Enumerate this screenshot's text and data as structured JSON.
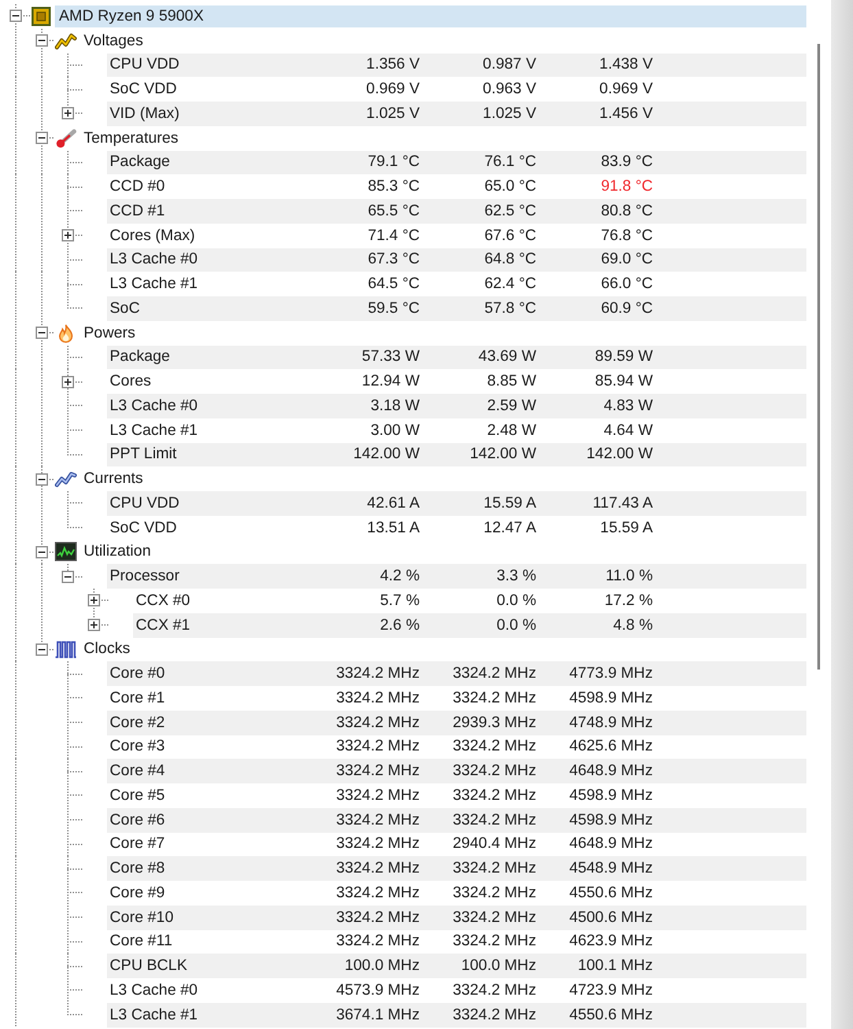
{
  "device": {
    "name": "AMD Ryzen 9 5900X",
    "expanded": true,
    "groups": [
      {
        "kind": "voltages",
        "label": "Voltages",
        "expanded": true,
        "sensors": [
          {
            "label": "CPU VDD",
            "values": [
              "1.356 V",
              "0.987 V",
              "1.438 V"
            ],
            "alerts": [
              false,
              false,
              false
            ]
          },
          {
            "label": "SoC VDD",
            "values": [
              "0.969 V",
              "0.963 V",
              "0.969 V"
            ],
            "alerts": [
              false,
              false,
              false
            ]
          },
          {
            "label": "VID (Max)",
            "expanded": false,
            "values": [
              "1.025 V",
              "1.025 V",
              "1.456 V"
            ],
            "alerts": [
              false,
              false,
              false
            ]
          }
        ]
      },
      {
        "kind": "temperatures",
        "label": "Temperatures",
        "expanded": true,
        "sensors": [
          {
            "label": "Package",
            "values": [
              "79.1 °C",
              "76.1 °C",
              "83.9 °C"
            ],
            "alerts": [
              false,
              false,
              false
            ]
          },
          {
            "label": "CCD #0",
            "values": [
              "85.3 °C",
              "65.0 °C",
              "91.8 °C"
            ],
            "alerts": [
              false,
              false,
              true
            ]
          },
          {
            "label": "CCD #1",
            "values": [
              "65.5 °C",
              "62.5 °C",
              "80.8 °C"
            ],
            "alerts": [
              false,
              false,
              false
            ]
          },
          {
            "label": "Cores (Max)",
            "expanded": false,
            "values": [
              "71.4 °C",
              "67.6 °C",
              "76.8 °C"
            ],
            "alerts": [
              false,
              false,
              false
            ]
          },
          {
            "label": "L3 Cache #0",
            "values": [
              "67.3 °C",
              "64.8 °C",
              "69.0 °C"
            ],
            "alerts": [
              false,
              false,
              false
            ]
          },
          {
            "label": "L3 Cache #1",
            "values": [
              "64.5 °C",
              "62.4 °C",
              "66.0 °C"
            ],
            "alerts": [
              false,
              false,
              false
            ]
          },
          {
            "label": "SoC",
            "values": [
              "59.5 °C",
              "57.8 °C",
              "60.9 °C"
            ],
            "alerts": [
              false,
              false,
              false
            ]
          }
        ]
      },
      {
        "kind": "powers",
        "label": "Powers",
        "expanded": true,
        "sensors": [
          {
            "label": "Package",
            "values": [
              "57.33 W",
              "43.69 W",
              "89.59 W"
            ],
            "alerts": [
              false,
              false,
              false
            ]
          },
          {
            "label": "Cores",
            "expanded": false,
            "values": [
              "12.94 W",
              "8.85 W",
              "85.94 W"
            ],
            "alerts": [
              false,
              false,
              false
            ]
          },
          {
            "label": "L3 Cache #0",
            "values": [
              "3.18 W",
              "2.59 W",
              "4.83 W"
            ],
            "alerts": [
              false,
              false,
              false
            ]
          },
          {
            "label": "L3 Cache #1",
            "values": [
              "3.00 W",
              "2.48 W",
              "4.64 W"
            ],
            "alerts": [
              false,
              false,
              false
            ]
          },
          {
            "label": "PPT Limit",
            "values": [
              "142.00 W",
              "142.00 W",
              "142.00 W"
            ],
            "alerts": [
              false,
              false,
              false
            ]
          }
        ]
      },
      {
        "kind": "currents",
        "label": "Currents",
        "expanded": true,
        "sensors": [
          {
            "label": "CPU VDD",
            "values": [
              "42.61 A",
              "15.59 A",
              "117.43 A"
            ],
            "alerts": [
              false,
              false,
              false
            ]
          },
          {
            "label": "SoC VDD",
            "values": [
              "13.51 A",
              "12.47 A",
              "15.59 A"
            ],
            "alerts": [
              false,
              false,
              false
            ]
          }
        ]
      },
      {
        "kind": "utilization",
        "label": "Utilization",
        "expanded": true,
        "sensors": [
          {
            "label": "Processor",
            "expanded": true,
            "values": [
              "4.2 %",
              "3.3 %",
              "11.0 %"
            ],
            "alerts": [
              false,
              false,
              false
            ],
            "children": [
              {
                "label": "CCX #0",
                "expanded": false,
                "values": [
                  "5.7 %",
                  "0.0 %",
                  "17.2 %"
                ],
                "alerts": [
                  false,
                  false,
                  false
                ]
              },
              {
                "label": "CCX #1",
                "expanded": false,
                "values": [
                  "2.6 %",
                  "0.0 %",
                  "4.8 %"
                ],
                "alerts": [
                  false,
                  false,
                  false
                ]
              }
            ]
          }
        ]
      },
      {
        "kind": "clocks",
        "label": "Clocks",
        "expanded": true,
        "sensors": [
          {
            "label": "Core #0",
            "values": [
              "3324.2 MHz",
              "3324.2 MHz",
              "4773.9 MHz"
            ],
            "alerts": [
              false,
              false,
              false
            ]
          },
          {
            "label": "Core #1",
            "values": [
              "3324.2 MHz",
              "3324.2 MHz",
              "4598.9 MHz"
            ],
            "alerts": [
              false,
              false,
              false
            ]
          },
          {
            "label": "Core #2",
            "values": [
              "3324.2 MHz",
              "2939.3 MHz",
              "4748.9 MHz"
            ],
            "alerts": [
              false,
              false,
              false
            ]
          },
          {
            "label": "Core #3",
            "values": [
              "3324.2 MHz",
              "3324.2 MHz",
              "4625.6 MHz"
            ],
            "alerts": [
              false,
              false,
              false
            ]
          },
          {
            "label": "Core #4",
            "values": [
              "3324.2 MHz",
              "3324.2 MHz",
              "4648.9 MHz"
            ],
            "alerts": [
              false,
              false,
              false
            ]
          },
          {
            "label": "Core #5",
            "values": [
              "3324.2 MHz",
              "3324.2 MHz",
              "4598.9 MHz"
            ],
            "alerts": [
              false,
              false,
              false
            ]
          },
          {
            "label": "Core #6",
            "values": [
              "3324.2 MHz",
              "3324.2 MHz",
              "4598.9 MHz"
            ],
            "alerts": [
              false,
              false,
              false
            ]
          },
          {
            "label": "Core #7",
            "values": [
              "3324.2 MHz",
              "2940.4 MHz",
              "4648.9 MHz"
            ],
            "alerts": [
              false,
              false,
              false
            ]
          },
          {
            "label": "Core #8",
            "values": [
              "3324.2 MHz",
              "3324.2 MHz",
              "4548.9 MHz"
            ],
            "alerts": [
              false,
              false,
              false
            ]
          },
          {
            "label": "Core #9",
            "values": [
              "3324.2 MHz",
              "3324.2 MHz",
              "4550.6 MHz"
            ],
            "alerts": [
              false,
              false,
              false
            ]
          },
          {
            "label": "Core #10",
            "values": [
              "3324.2 MHz",
              "3324.2 MHz",
              "4500.6 MHz"
            ],
            "alerts": [
              false,
              false,
              false
            ]
          },
          {
            "label": "Core #11",
            "values": [
              "3324.2 MHz",
              "3324.2 MHz",
              "4623.9 MHz"
            ],
            "alerts": [
              false,
              false,
              false
            ]
          },
          {
            "label": "CPU BCLK",
            "values": [
              "100.0 MHz",
              "100.0 MHz",
              "100.1 MHz"
            ],
            "alerts": [
              false,
              false,
              false
            ]
          },
          {
            "label": "L3 Cache #0",
            "values": [
              "4573.9 MHz",
              "3324.2 MHz",
              "4723.9 MHz"
            ],
            "alerts": [
              false,
              false,
              false
            ]
          },
          {
            "label": "L3 Cache #1",
            "values": [
              "3674.1 MHz",
              "3324.2 MHz",
              "4550.6 MHz"
            ],
            "alerts": [
              false,
              false,
              false
            ]
          }
        ]
      }
    ]
  }
}
